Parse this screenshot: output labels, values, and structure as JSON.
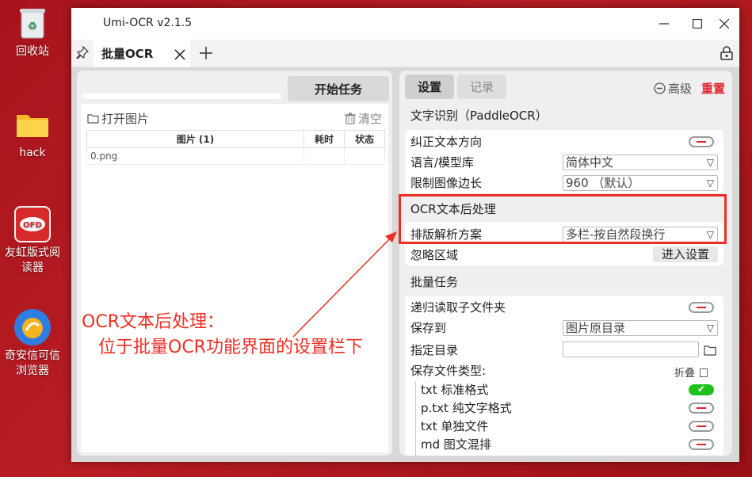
{
  "desktop": {
    "icons": [
      {
        "label": "回收站"
      },
      {
        "label": "hack"
      },
      {
        "label": "友虹版式阅读器"
      },
      {
        "label": "奇安信可信浏览器"
      }
    ]
  },
  "window": {
    "title": "Umi-OCR v2.1.5",
    "tab_label": "批量OCR"
  },
  "left": {
    "start_button": "开始任务",
    "open_images": "打开图片",
    "clear": "清空",
    "columns": [
      "图片 (1)",
      "耗时",
      "状态"
    ],
    "rows": [
      [
        "0.png",
        "",
        ""
      ]
    ]
  },
  "right": {
    "tab_settings": "设置",
    "tab_history": "记录",
    "advanced": "高级",
    "reset": "重置",
    "ocr_section": "文字识别（PaddleOCR）",
    "fix_direction": "纠正文本方向",
    "language_label": "语言/模型库",
    "language_value": "简体中文",
    "limit_label": "限制图像边长",
    "limit_value": "960 （默认）",
    "post_section": "OCR文本后处理",
    "layout_label": "排版解析方案",
    "layout_value": "多栏-按自然段换行",
    "ignore_label": "忽略区域",
    "ignore_button": "进入设置",
    "batch_section": "批量任务",
    "recursive_label": "递归读取子文件夹",
    "save_to_label": "保存到",
    "save_to_value": "图片原目录",
    "dir_label": "指定目录",
    "file_types_label": "保存文件类型:",
    "collapse": "折叠",
    "types": [
      {
        "label": "txt 标准格式",
        "on": true
      },
      {
        "label": "p.txt 纯文字格式",
        "on": false
      },
      {
        "label": "txt 单独文件",
        "on": false
      },
      {
        "label": "md 图文混排",
        "on": false
      }
    ]
  },
  "annotation": {
    "line1": "OCR文本后处理：",
    "line2": "位于批量OCR功能界面的设置栏下",
    "color": "#ee2e24"
  }
}
